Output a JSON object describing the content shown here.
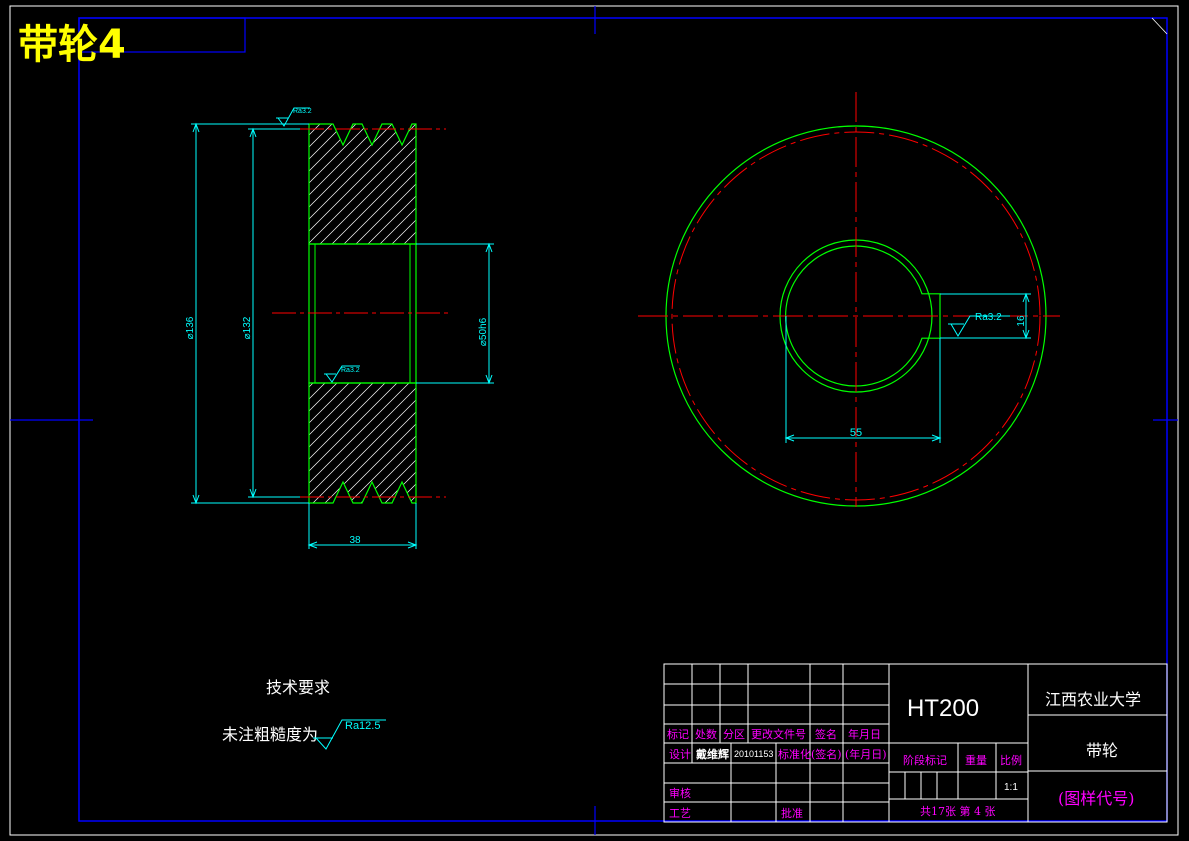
{
  "title": "带轮4",
  "colors": {
    "background": "#000000",
    "frame": "#0000ff",
    "outline": "#00ff00",
    "dimension": "#00ffff",
    "center_line": "#ff0000",
    "table_label": "#ff00ff",
    "text": "#ffffff",
    "title": "#ffff00"
  },
  "section_view": {
    "roughness_top": "Ra3.2",
    "roughness_bore": "Ra3.2",
    "dim_outer_diameter": "⌀136",
    "dim_pitch_diameter": "⌀132",
    "dim_bore": "⌀50h6",
    "dim_width": "38"
  },
  "front_view": {
    "roughness_keyway": "Ra3.2",
    "dim_keyway_width": "16",
    "dim_keyway_depth": "55"
  },
  "tech_requirements": {
    "heading": "技术要求",
    "note": "未注粗糙度为",
    "roughness": "Ra12.5"
  },
  "title_block": {
    "material": "HT200",
    "school": "江西农业大学",
    "part_name": "带轮",
    "drawing_code": "(图样代号)",
    "headers": [
      "标记",
      "处数",
      "分区",
      "更改文件号",
      "签名",
      "年月日"
    ],
    "designer_label": "设计",
    "designer_name": "戴维辉",
    "designer_id": "20101153",
    "standardize_label": "标准化",
    "sign_label": "(签名)",
    "date_label": "(年月日)",
    "review_label": "审核",
    "process_label": "工艺",
    "approve_label": "批准",
    "stage_label": "阶段标记",
    "weight_label": "重量",
    "scale_label": "比例",
    "scale_value": "1:1",
    "sheets": "共17张  第 4 张"
  }
}
